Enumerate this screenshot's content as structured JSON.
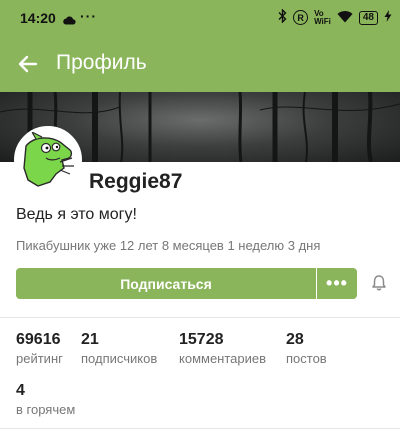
{
  "status_bar": {
    "time": "14:20",
    "dots": "···",
    "r_badge": "R",
    "network_label_top": "Vo",
    "network_label_bottom": "WiFi",
    "battery": "48"
  },
  "app_bar": {
    "title": "Профиль"
  },
  "profile": {
    "username": "Reggie87",
    "bio": "Ведь я это могу!",
    "member_since": "Пикабушник уже 12 лет 8 месяцев 1 неделю 3 дня"
  },
  "actions": {
    "subscribe_label": "Подписаться",
    "more_label": "•••"
  },
  "stats": [
    {
      "value": "69616",
      "label": "рейтинг"
    },
    {
      "value": "21",
      "label": "подписчиков"
    },
    {
      "value": "15728",
      "label": "комментариев"
    },
    {
      "value": "28",
      "label": "постов"
    },
    {
      "value": "4",
      "label": "в горячем"
    }
  ],
  "colors": {
    "accent": "#8ab55a",
    "avatar_green": "#7cd64a"
  }
}
